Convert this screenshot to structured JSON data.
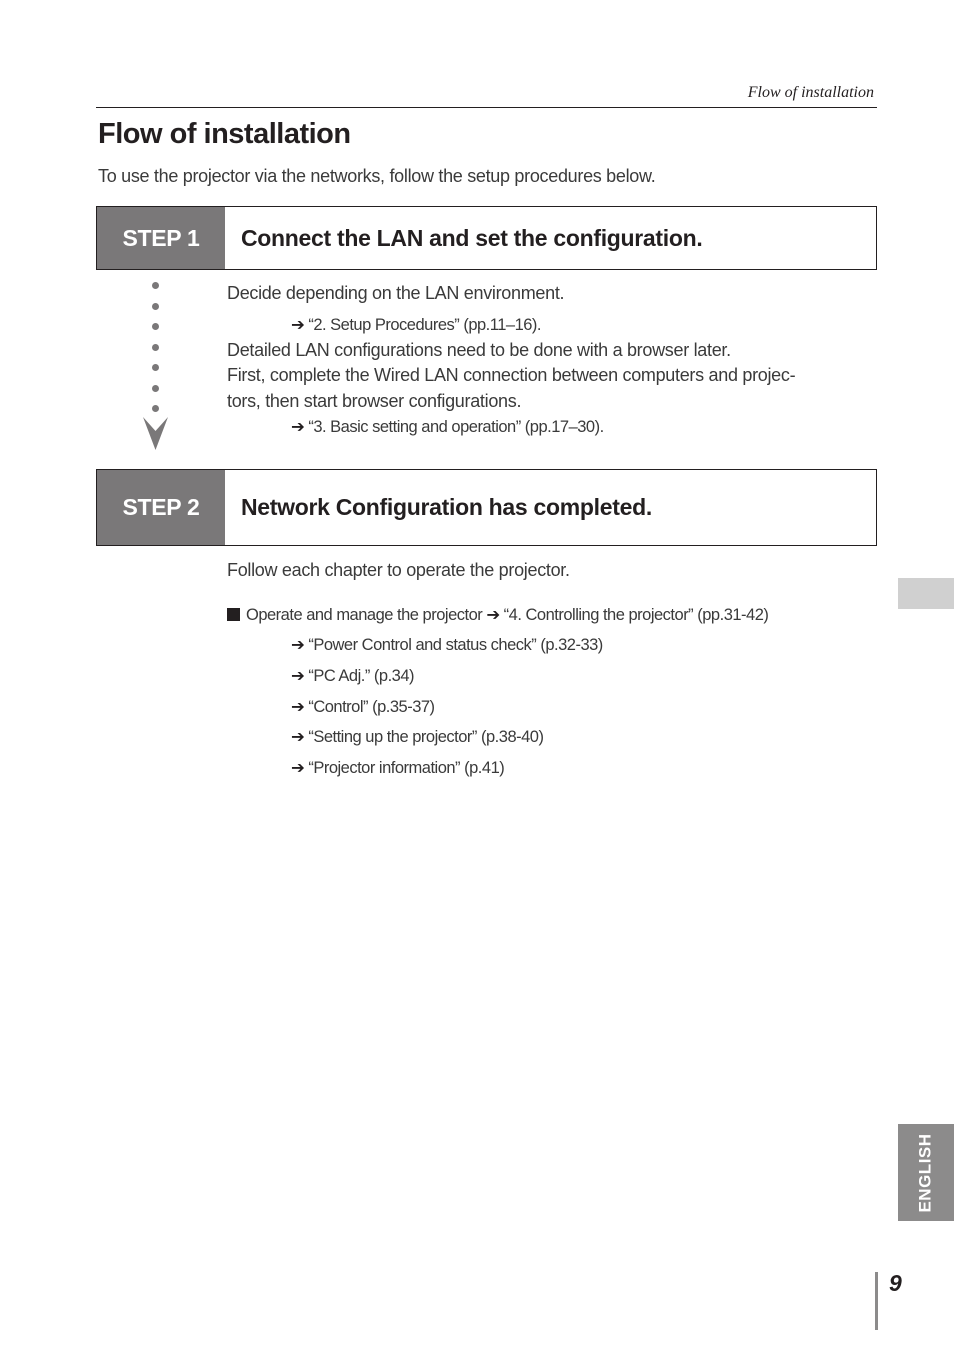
{
  "header": {
    "running_head": "Flow of installation",
    "title": "Flow of installation",
    "intro": "To use the projector via the networks, follow the setup procedures below."
  },
  "steps": [
    {
      "tag": "STEP 1",
      "title": "Connect the LAN and set the configuration.",
      "lines": [
        "Decide depending on the LAN environment.",
        "Detailed LAN configurations need to be done with a browser later.",
        "First, complete the Wired LAN connection between computers and projec-",
        "tors, then start browser configurations."
      ],
      "refs": [
        "“2. Setup Procedures” (pp.11–16).",
        "“3. Basic setting and operation” (pp.17–30)."
      ]
    },
    {
      "tag": "STEP 2",
      "title": "Network Configuration has completed.",
      "intro": "Follow each chapter to operate the projector.",
      "bullet": {
        "text": "Operate and manage the projector",
        "ref": "“4. Controlling the projector” (pp.31-42)"
      },
      "refs": [
        "“Power Control and status check” (p.32-33)",
        "“PC Adj.” (p.34)",
        "“Control” (p.35-37)",
        "“Setting up the projector” (p.38-40)",
        "“Projector information” (p.41)"
      ]
    }
  ],
  "icons": {
    "arrow": "➔",
    "bullet": "square-bullet-icon",
    "flow": "dotted-down-arrow-icon"
  },
  "footer": {
    "language_tab": "ENGLISH",
    "page_number": "9"
  },
  "colors": {
    "step_tag_bg": "#7a7879",
    "language_tab_bg": "#8c8b8b",
    "side_tab_bg": "#d0d0d0",
    "text": "#231f20"
  }
}
